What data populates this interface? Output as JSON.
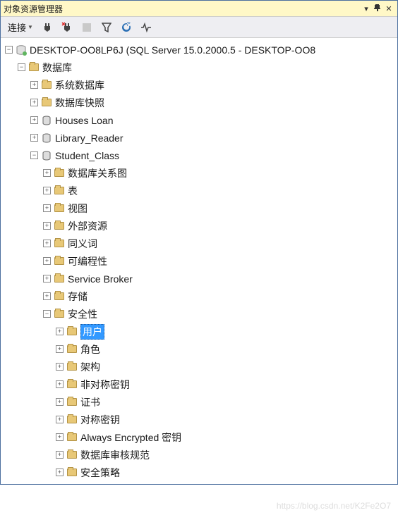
{
  "panel": {
    "title": "对象资源管理器"
  },
  "toolbar": {
    "connect_label": "连接"
  },
  "tree": {
    "server": {
      "label": "DESKTOP-OO8LP6J (SQL Server 15.0.2000.5 - DESKTOP-OO8"
    },
    "databases_label": "数据库",
    "sys_db_label": "系统数据库",
    "db_snapshot_label": "数据库快照",
    "houses_loan_label": "Houses Loan",
    "library_reader_label": "Library_Reader",
    "student_class_label": "Student_Class",
    "db_diagram_label": "数据库关系图",
    "tables_label": "表",
    "views_label": "视图",
    "external_res_label": "外部资源",
    "synonyms_label": "同义词",
    "programmability_label": "可编程性",
    "service_broker_label": "Service Broker",
    "storage_label": "存储",
    "security_label": "安全性",
    "users_label": "用户",
    "roles_label": "角色",
    "schemas_label": "架构",
    "asym_keys_label": "非对称密钥",
    "certs_label": "证书",
    "sym_keys_label": "对称密钥",
    "always_encrypted_label": "Always Encrypted 密钥",
    "db_audit_label": "数据库审核规范",
    "security_policy_label": "安全策略"
  },
  "watermark": "https://blog.csdn.net/K2Fe2O7"
}
